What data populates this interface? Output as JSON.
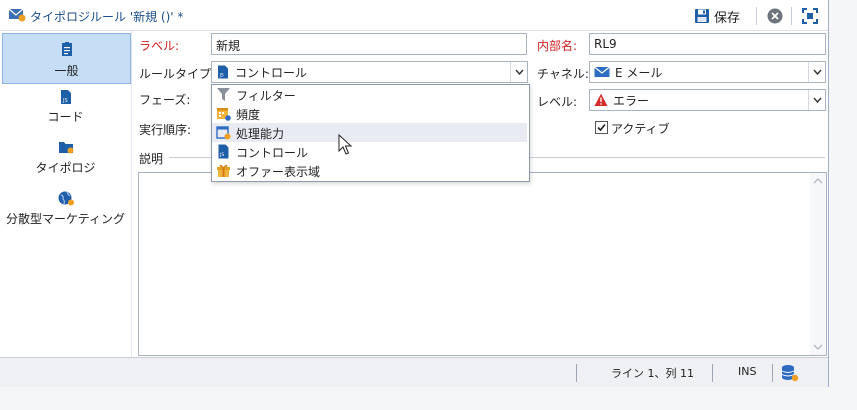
{
  "window": {
    "title": "タイポロジルール '新規 ()' *",
    "save_label": "保存"
  },
  "sidebar": {
    "items": [
      {
        "label": "一般",
        "icon": "general-icon",
        "active": true
      },
      {
        "label": "コード",
        "icon": "js-code-icon",
        "active": false
      },
      {
        "label": "タイポロジ",
        "icon": "typology-folder-icon",
        "active": false
      },
      {
        "label": "分散型マーケティング",
        "icon": "globe-icon",
        "active": false
      }
    ]
  },
  "form": {
    "label_caption": "ラベル:",
    "label_value": "新規",
    "internal_name_caption": "内部名:",
    "internal_name_value": "RL9",
    "rule_type_caption": "ルールタイプ:",
    "rule_type_value": "コントロール",
    "channel_caption": "チャネル:",
    "channel_value": "E メール",
    "phase_caption": "フェーズ:",
    "level_caption": "レベル:",
    "level_value": "エラー",
    "order_caption": "実行順序:",
    "active_caption": "アクティブ",
    "active_checked": true,
    "description_caption": "説明"
  },
  "rule_type_dropdown": {
    "options": [
      {
        "label": "フィルター",
        "icon": "filter-icon"
      },
      {
        "label": "頻度",
        "icon": "frequency-calendar-icon"
      },
      {
        "label": "処理能力",
        "icon": "capacity-calendar-icon",
        "hover": true
      },
      {
        "label": "コントロール",
        "icon": "js-control-icon"
      },
      {
        "label": "オファー表示域",
        "icon": "gift-icon"
      }
    ]
  },
  "status": {
    "position": "ライン 1、列 11",
    "mode": "INS"
  },
  "colors": {
    "required_label": "#d02020",
    "active_tab": "#c6def5",
    "title_text": "#1a4e8a"
  }
}
